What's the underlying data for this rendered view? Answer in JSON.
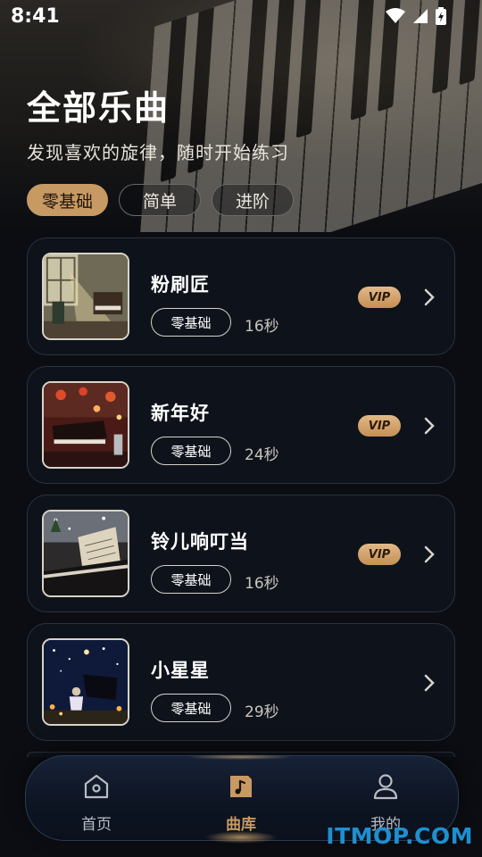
{
  "status_bar": {
    "time": "8:41"
  },
  "header": {
    "title": "全部乐曲",
    "subtitle": "发现喜欢的旋律，随时开始练习"
  },
  "filters": [
    {
      "label": "零基础",
      "active": true
    },
    {
      "label": "简单",
      "active": false
    },
    {
      "label": "进阶",
      "active": false
    }
  ],
  "songs": [
    {
      "title": "粉刷匠",
      "level": "零基础",
      "duration": "16秒",
      "vip": true,
      "vip_label": "VIP",
      "thumb": "piano-room-image"
    },
    {
      "title": "新年好",
      "level": "零基础",
      "duration": "24秒",
      "vip": true,
      "vip_label": "VIP",
      "thumb": "new-year-piano-image"
    },
    {
      "title": "铃儿响叮当",
      "level": "零基础",
      "duration": "16秒",
      "vip": true,
      "vip_label": "VIP",
      "thumb": "christmas-sheet-music-image"
    },
    {
      "title": "小星星",
      "level": "零基础",
      "duration": "29秒",
      "vip": false,
      "thumb": "starry-night-piano-image"
    }
  ],
  "tabbar": [
    {
      "label": "首页",
      "icon": "home-icon",
      "active": false
    },
    {
      "label": "曲库",
      "icon": "music-library-icon",
      "active": true
    },
    {
      "label": "我的",
      "icon": "profile-icon",
      "active": false
    }
  ],
  "watermark": "ITMOP.COM",
  "colors": {
    "accent": "#c79a63",
    "card_bg": "#0e131b",
    "card_border": "#2b3140",
    "tab_inactive": "#b9bcc3"
  }
}
